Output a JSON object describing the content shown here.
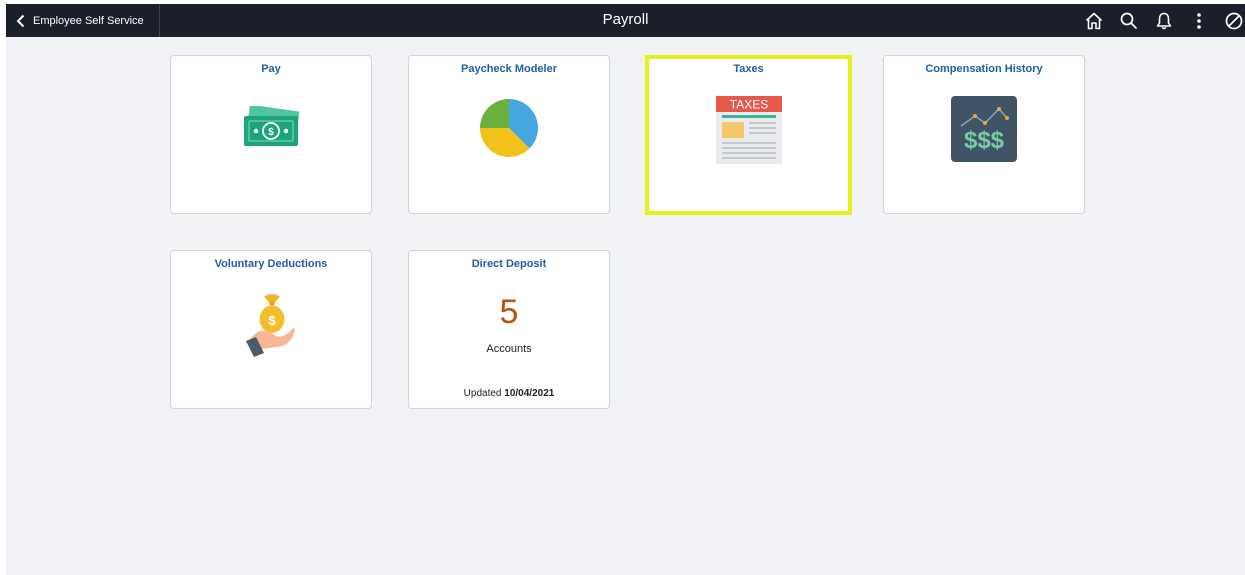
{
  "header": {
    "back_label": "Employee Self Service",
    "title": "Payroll",
    "icons": [
      "home-icon",
      "search-icon",
      "bell-icon",
      "more-vertical-icon",
      "no-sign-icon"
    ]
  },
  "tiles": [
    {
      "title": "Pay",
      "icon": "money-icon"
    },
    {
      "title": "Paycheck Modeler",
      "icon": "pie-chart-icon"
    },
    {
      "title": "Taxes",
      "icon": "tax-document-icon",
      "selected": true,
      "graphic_text": "TAXES"
    },
    {
      "title": "Compensation History",
      "icon": "dollar-chart-icon",
      "graphic_text": "$$$"
    },
    {
      "title": "Voluntary Deductions",
      "icon": "hand-money-bag-icon",
      "graphic_text": "$"
    },
    {
      "title": "Direct Deposit",
      "count": "5",
      "count_label": "Accounts",
      "updated_label": "Updated",
      "updated_date": "10/04/2021"
    }
  ],
  "colors": {
    "topbar": "#1b1f2a",
    "background": "#f1f2f5",
    "tile_title": "#1f5fa4",
    "selection": "#e3f21a",
    "count": "#b0560f"
  }
}
